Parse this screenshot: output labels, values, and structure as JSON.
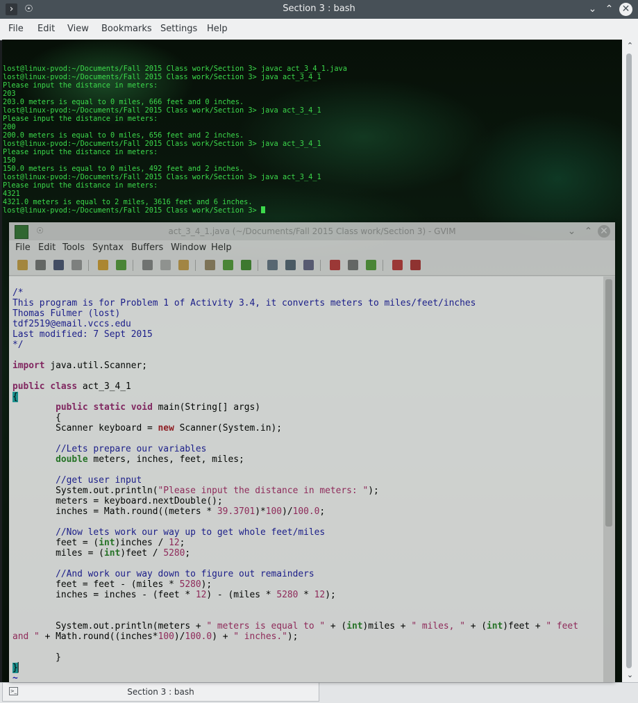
{
  "konsole": {
    "title": "Section 3 : bash",
    "menu": [
      "File",
      "Edit",
      "View",
      "Bookmarks",
      "Settings",
      "Help"
    ],
    "lines": [
      "lost@linux-pvod:~/Documents/Fall 2015 Class work/Section 3> javac act_3_4_1.java",
      "lost@linux-pvod:~/Documents/Fall 2015 Class work/Section 3> java act_3_4_1",
      "Please input the distance in meters:",
      "203",
      "203.0 meters is equal to 0 miles, 666 feet and 0 inches.",
      "lost@linux-pvod:~/Documents/Fall 2015 Class work/Section 3> java act_3_4_1",
      "Please input the distance in meters:",
      "200",
      "200.0 meters is equal to 0 miles, 656 feet and 2 inches.",
      "lost@linux-pvod:~/Documents/Fall 2015 Class work/Section 3> java act_3_4_1",
      "Please input the distance in meters:",
      "150",
      "150.0 meters is equal to 0 miles, 492 feet and 2 inches.",
      "lost@linux-pvod:~/Documents/Fall 2015 Class work/Section 3> java act_3_4_1",
      "Please input the distance in meters:",
      "4321",
      "4321.0 meters is equal to 2 miles, 3616 feet and 6 inches.",
      "lost@linux-pvod:~/Documents/Fall 2015 Class work/Section 3> "
    ],
    "tab_label": "Section 3 : bash",
    "text_color": "#3cd94b"
  },
  "gvim": {
    "title": "act_3_4_1.java (~/Documents/Fall 2015 Class work/Section 3) - GVIM",
    "menu": [
      "File",
      "Edit",
      "Tools",
      "Syntax",
      "Buffers",
      "Window",
      "Help"
    ],
    "toolbar": [
      "open-icon",
      "save-icon",
      "save-all-icon",
      "print-icon",
      "undo-icon",
      "redo-icon",
      "cut-icon",
      "copy-icon",
      "paste-icon",
      "find-replace-icon",
      "find-next-icon",
      "find-prev-icon",
      "load-session-icon",
      "save-session-icon",
      "run-script-icon",
      "make-icon",
      "shell-icon",
      "ctags-jump-icon",
      "help-icon",
      "find-help-icon"
    ],
    "code": [
      [
        [
          "c",
          "/*"
        ]
      ],
      [
        [
          "c",
          "This program is for Problem 1 of Activity 3.4, it converts meters to miles/feet/inches"
        ]
      ],
      [
        [
          "c",
          "Thomas Fulmer (lost)"
        ]
      ],
      [
        [
          "c",
          "tdf2519@email.vccs.edu"
        ]
      ],
      [
        [
          "c",
          "Last modified: 7 Sept 2015"
        ]
      ],
      [
        [
          "c",
          "*/"
        ]
      ],
      [],
      [
        [
          "k",
          "import"
        ],
        [
          "p",
          " java.util.Scanner;"
        ]
      ],
      [],
      [
        [
          "k",
          "public"
        ],
        [
          "p",
          " "
        ],
        [
          "k",
          "class"
        ],
        [
          "p",
          " act_3_4_1"
        ]
      ],
      [
        [
          "brace",
          "{"
        ]
      ],
      [
        [
          "p",
          "        "
        ],
        [
          "k",
          "public"
        ],
        [
          "p",
          " "
        ],
        [
          "k",
          "static"
        ],
        [
          "p",
          " "
        ],
        [
          "k",
          "void"
        ],
        [
          "p",
          " main(String[] args)"
        ]
      ],
      [
        [
          "p",
          "        {"
        ]
      ],
      [
        [
          "p",
          "        Scanner keyboard = "
        ],
        [
          "kr",
          "new"
        ],
        [
          "p",
          " Scanner(System.in);"
        ]
      ],
      [],
      [
        [
          "p",
          "        "
        ],
        [
          "c",
          "//Lets prepare our variables"
        ]
      ],
      [
        [
          "p",
          "        "
        ],
        [
          "t",
          "double"
        ],
        [
          "p",
          " meters, inches, feet, miles;"
        ]
      ],
      [],
      [
        [
          "p",
          "        "
        ],
        [
          "c",
          "//get user input"
        ]
      ],
      [
        [
          "p",
          "        System.out.println("
        ],
        [
          "s",
          "\"Please input the distance in meters: \""
        ],
        [
          "p",
          ");"
        ]
      ],
      [
        [
          "p",
          "        meters = keyboard.nextDouble();"
        ]
      ],
      [
        [
          "p",
          "        inches = Math.round((meters * "
        ],
        [
          "n",
          "39.3701"
        ],
        [
          "p",
          ")*"
        ],
        [
          "n",
          "100"
        ],
        [
          "p",
          ")/"
        ],
        [
          "n",
          "100.0"
        ],
        [
          "p",
          ";"
        ]
      ],
      [],
      [
        [
          "p",
          "        "
        ],
        [
          "c",
          "//Now lets work our way up to get whole feet/miles"
        ]
      ],
      [
        [
          "p",
          "        feet = ("
        ],
        [
          "t",
          "int"
        ],
        [
          "p",
          ")inches / "
        ],
        [
          "n",
          "12"
        ],
        [
          "p",
          ";"
        ]
      ],
      [
        [
          "p",
          "        miles = ("
        ],
        [
          "t",
          "int"
        ],
        [
          "p",
          ")feet / "
        ],
        [
          "n",
          "5280"
        ],
        [
          "p",
          ";"
        ]
      ],
      [],
      [
        [
          "p",
          "        "
        ],
        [
          "c",
          "//And work our way down to figure out remainders"
        ]
      ],
      [
        [
          "p",
          "        feet = feet - (miles * "
        ],
        [
          "n",
          "5280"
        ],
        [
          "p",
          ");"
        ]
      ],
      [
        [
          "p",
          "        inches = inches - (feet * "
        ],
        [
          "n",
          "12"
        ],
        [
          "p",
          ") - (miles * "
        ],
        [
          "n",
          "5280"
        ],
        [
          "p",
          " * "
        ],
        [
          "n",
          "12"
        ],
        [
          "p",
          ");"
        ]
      ],
      [],
      [],
      [
        [
          "p",
          "        System.out.println(meters + "
        ],
        [
          "s",
          "\" meters is equal to \""
        ],
        [
          "p",
          " + ("
        ],
        [
          "t",
          "int"
        ],
        [
          "p",
          ")miles + "
        ],
        [
          "s",
          "\" miles, \""
        ],
        [
          "p",
          " + ("
        ],
        [
          "t",
          "int"
        ],
        [
          "p",
          ")feet + "
        ],
        [
          "s",
          "\" feet"
        ]
      ],
      [
        [
          "s",
          "and \""
        ],
        [
          "p",
          " + Math.round((inches*"
        ],
        [
          "n",
          "100"
        ],
        [
          "p",
          ")/"
        ],
        [
          "n",
          "100.0"
        ],
        [
          "p",
          ") + "
        ],
        [
          "s",
          "\" inches.\""
        ],
        [
          "p",
          ");"
        ]
      ],
      [],
      [
        [
          "p",
          "        }"
        ]
      ],
      [
        [
          "brace",
          "}"
        ],
        [
          "p",
          "▏"
        ]
      ],
      [
        [
          "tilde",
          "~"
        ]
      ]
    ]
  }
}
